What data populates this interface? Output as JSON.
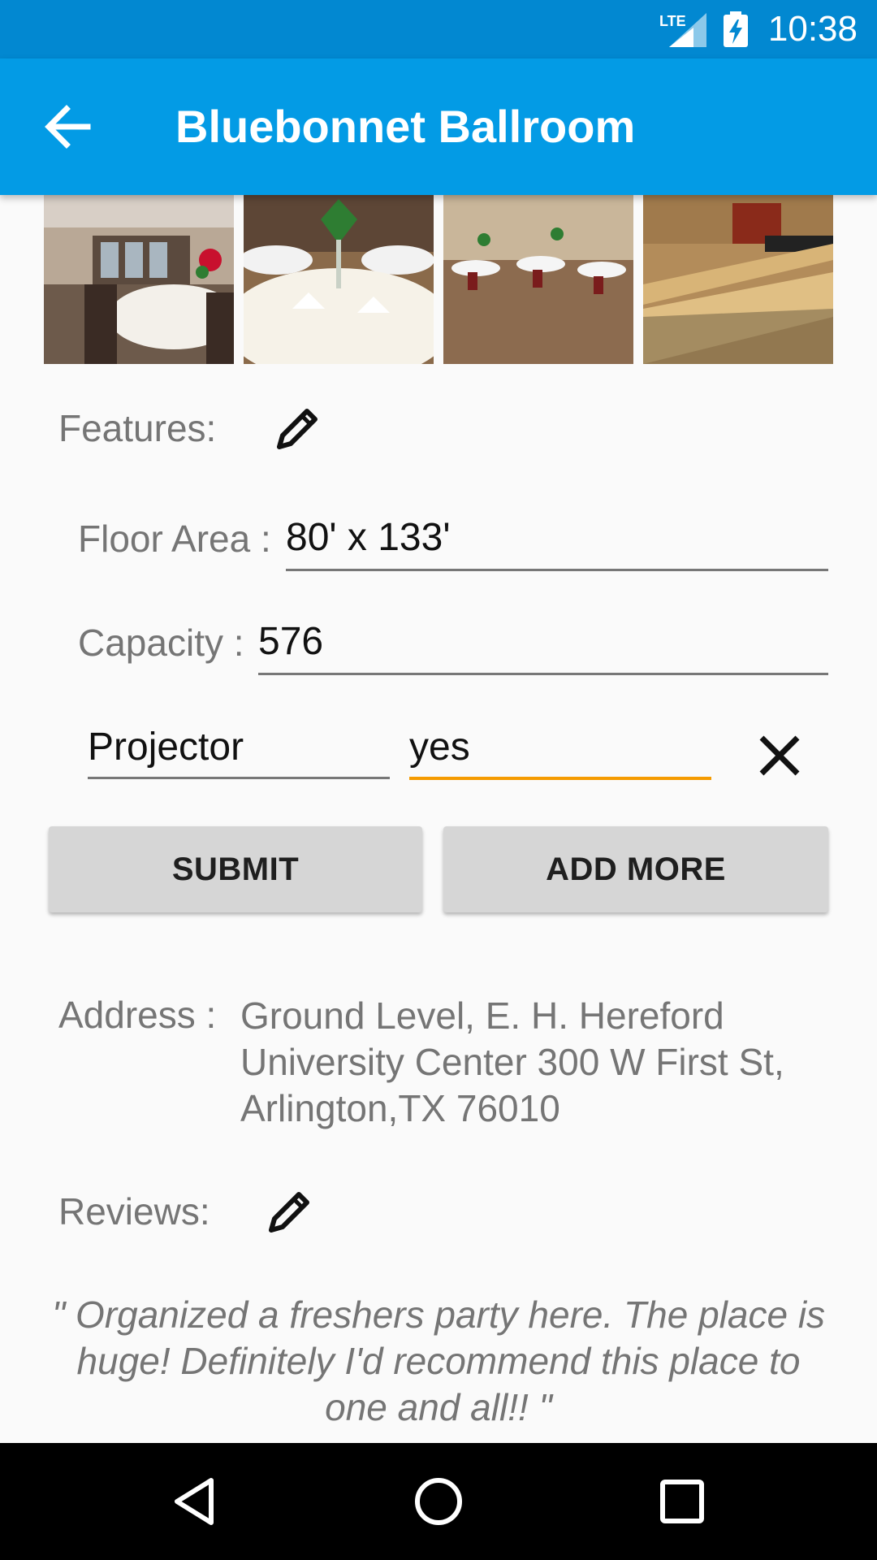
{
  "status_bar": {
    "time": "10:38",
    "network": "LTE"
  },
  "app_bar": {
    "title": "Bluebonnet Ballroom"
  },
  "gallery": {
    "photo_count": 4
  },
  "features": {
    "label": "Features:",
    "floor_area": {
      "label": "Floor Area :",
      "value": "80' x 133'"
    },
    "capacity": {
      "label": "Capacity :",
      "value": "576"
    },
    "custom": {
      "name": "Projector",
      "value": "yes"
    }
  },
  "buttons": {
    "submit": "SUBMIT",
    "add_more": "ADD MORE"
  },
  "address": {
    "label": "Address :",
    "value": "Ground Level, E. H. Hereford University Center 300 W First St, Arlington,TX 76010"
  },
  "reviews": {
    "label": "Reviews:",
    "text": "\" Organized a freshers party here. The place is huge! Definitely I'd recommend this place to one and all!!  \""
  },
  "colors": {
    "status_bar": "#0288d1",
    "app_bar": "#039be5",
    "accent": "#f59b00",
    "button": "#d6d6d6"
  }
}
